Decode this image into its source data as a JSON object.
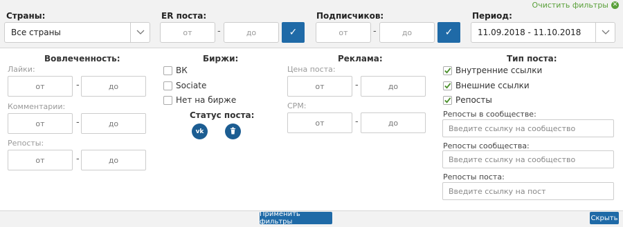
{
  "header": {
    "clear_filters": "Очистить фильтры",
    "countries_label": "Страны:",
    "countries_value": "Все страны",
    "er_label": "ER поста:",
    "subscribers_label": "Подписчиков:",
    "period_label": "Период:",
    "period_value": "11.09.2018 - 11.10.2018",
    "from": "от",
    "to": "до",
    "dash": "-"
  },
  "engagement": {
    "title": "Вовлеченность:",
    "likes": "Лайки:",
    "comments": "Комментарии:",
    "reposts": "Репосты:"
  },
  "exchanges": {
    "title": "Биржи:",
    "items": [
      {
        "label": "ВК",
        "checked": false
      },
      {
        "label": "Sociate",
        "checked": false
      },
      {
        "label": "Нет на бирже",
        "checked": false
      }
    ],
    "status_title": "Статус поста:",
    "vk_icon_text": "vk"
  },
  "ads": {
    "title": "Реклама:",
    "price": "Цена поста:",
    "cpm": "CPM:"
  },
  "post_type": {
    "title": "Тип поста:",
    "items": [
      {
        "label": "Внутренние ссылки",
        "checked": true
      },
      {
        "label": "Внешние ссылки",
        "checked": true
      },
      {
        "label": "Репосты",
        "checked": true
      }
    ],
    "reposts_in_community": "Репосты в сообществе:",
    "reposts_in_community_ph": "Введите ссылку на сообщество",
    "community_reposts": "Репосты сообщества:",
    "community_reposts_ph": "Введите ссылку на сообщество",
    "post_reposts": "Репосты поста:",
    "post_reposts_ph": "Введите ссылку на пост"
  },
  "footer": {
    "apply": "Применить фильтры",
    "hide": "Скрыть"
  },
  "colors": {
    "accent": "#1f6aa7",
    "clear_green": "#5aa03a",
    "check_green": "#4a8f2a"
  }
}
